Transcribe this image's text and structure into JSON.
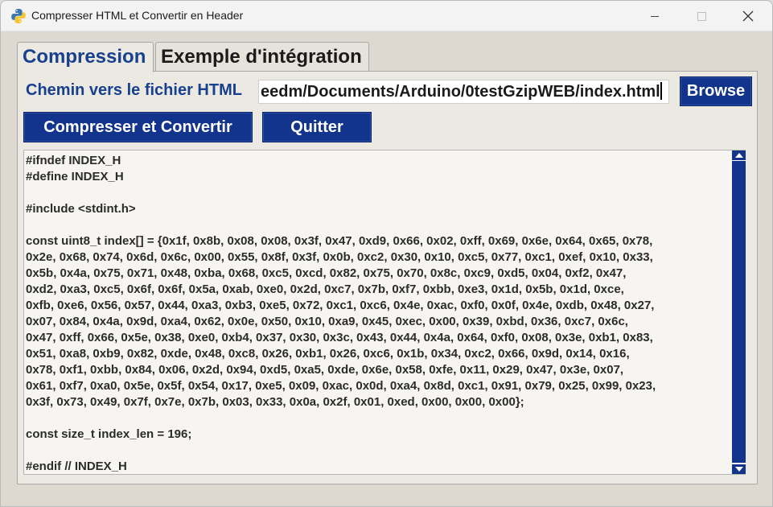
{
  "window": {
    "title": "Compresser HTML et Convertir en Header",
    "app_icon": "python-icon",
    "controls": [
      "minimize-icon",
      "maximize-icon",
      "close-icon"
    ]
  },
  "tabs": [
    {
      "label": "Compression",
      "active": true
    },
    {
      "label": "Exemple d'intégration",
      "active": false
    }
  ],
  "form": {
    "path_label": "Chemin vers le fichier HTML",
    "path_value": "eedm/Documents/Arduino/0testGzipWEB/index.html",
    "browse_label": "Browse",
    "compress_label": "Compresser et Convertir",
    "quit_label": "Quitter"
  },
  "output": {
    "lines": [
      "#ifndef INDEX_H",
      "#define INDEX_H",
      "",
      "#include <stdint.h>",
      "",
      "const uint8_t index[] = {0x1f, 0x8b, 0x08, 0x08, 0x3f, 0x47, 0xd9, 0x66, 0x02, 0xff, 0x69, 0x6e, 0x64, 0x65, 0x78,",
      "0x2e, 0x68, 0x74, 0x6d, 0x6c, 0x00, 0x55, 0x8f, 0x3f, 0x0b, 0xc2, 0x30, 0x10, 0xc5, 0x77, 0xc1, 0xef, 0x10, 0x33,",
      "0x5b, 0x4a, 0x75, 0x71, 0x48, 0xba, 0x68, 0xc5, 0xcd, 0x82, 0x75, 0x70, 0x8c, 0xc9, 0xd5, 0x04, 0xf2, 0x47,",
      "0xd2, 0xa3, 0xc5, 0x6f, 0x6f, 0x5a, 0xab, 0xe0, 0x2d, 0xc7, 0x7b, 0xf7, 0xbb, 0xe3, 0x1d, 0x5b, 0x1d, 0xce,",
      "0xfb, 0xe6, 0x56, 0x57, 0x44, 0xa3, 0xb3, 0xe5, 0x72, 0xc1, 0xc6, 0x4e, 0xac, 0xf0, 0x0f, 0x4e, 0xdb, 0x48, 0x27,",
      "0x07, 0x84, 0x4a, 0x9d, 0xa4, 0x62, 0x0e, 0x50, 0x10, 0xa9, 0x45, 0xec, 0x00, 0x39, 0xbd, 0x36, 0xc7, 0x6c,",
      "0x47, 0xff, 0x66, 0x5e, 0x38, 0xe0, 0xb4, 0x37, 0x30, 0x3c, 0x43, 0x44, 0x4a, 0x64, 0xf0, 0x08, 0x3e, 0xb1, 0x83,",
      "0x51, 0xa8, 0xb9, 0x82, 0xde, 0x48, 0xc8, 0x26, 0xb1, 0x26, 0xc6, 0x1b, 0x34, 0xc2, 0x66, 0x9d, 0x14, 0x16,",
      "0x78, 0xf1, 0xbb, 0x84, 0x06, 0x2d, 0x94, 0xd5, 0xa5, 0xde, 0x6e, 0x58, 0xfe, 0x11, 0x29, 0x47, 0x3e, 0x07,",
      "0x61, 0xf7, 0xa0, 0x5e, 0x5f, 0x54, 0x17, 0xe5, 0x09, 0xac, 0x0d, 0xa4, 0x8d, 0xc1, 0x91, 0x79, 0x25, 0x99, 0x23,",
      "0x3f, 0x73, 0x49, 0x7f, 0x7e, 0x7b, 0x03, 0x33, 0x0a, 0x2f, 0x01, 0xed, 0x00, 0x00, 0x00};",
      "",
      "const size_t index_len = 196;",
      "",
      "#endif // INDEX_H"
    ]
  },
  "colors": {
    "accent": "#13348c",
    "tab_active_text": "#17408f",
    "window_bg": "#ddd9d0"
  }
}
